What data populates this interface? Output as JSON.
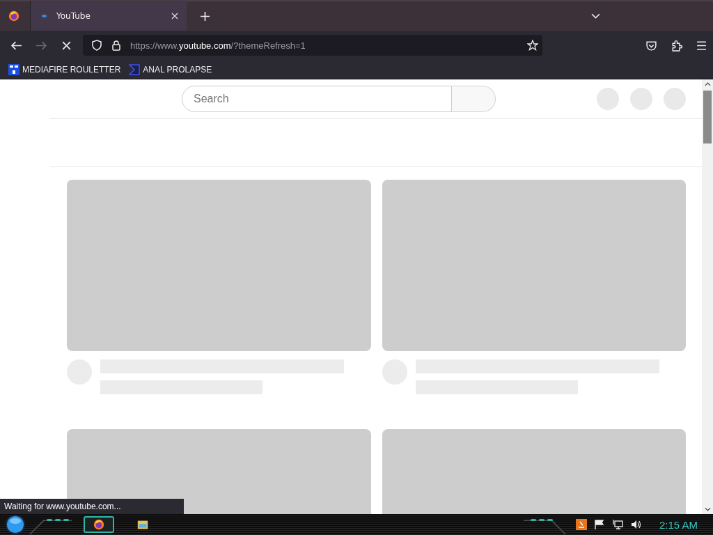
{
  "browser": {
    "tabs": [
      {
        "title": "YouTube",
        "selected": true
      }
    ],
    "loading": true,
    "forward_disabled": true,
    "url": {
      "prefix": "https://www.",
      "domain": "youtube.com",
      "path": "/?themeRefresh=1"
    },
    "bookmarks": [
      {
        "label": "MEDIAFIRE ROULETTER",
        "kind": "mft"
      },
      {
        "label": "ANAL PROLAPSE",
        "kind": "sigma"
      }
    ]
  },
  "page": {
    "search": {
      "placeholder": "Search"
    },
    "video_cards": [
      {
        "kind": "skeleton"
      },
      {
        "kind": "skeleton"
      },
      {
        "kind": "thumbnail-only"
      },
      {
        "kind": "thumbnail-only"
      }
    ]
  },
  "status_text": "Waiting for www.youtube.com...",
  "taskbar": {
    "clock": "2:15 AM"
  }
}
